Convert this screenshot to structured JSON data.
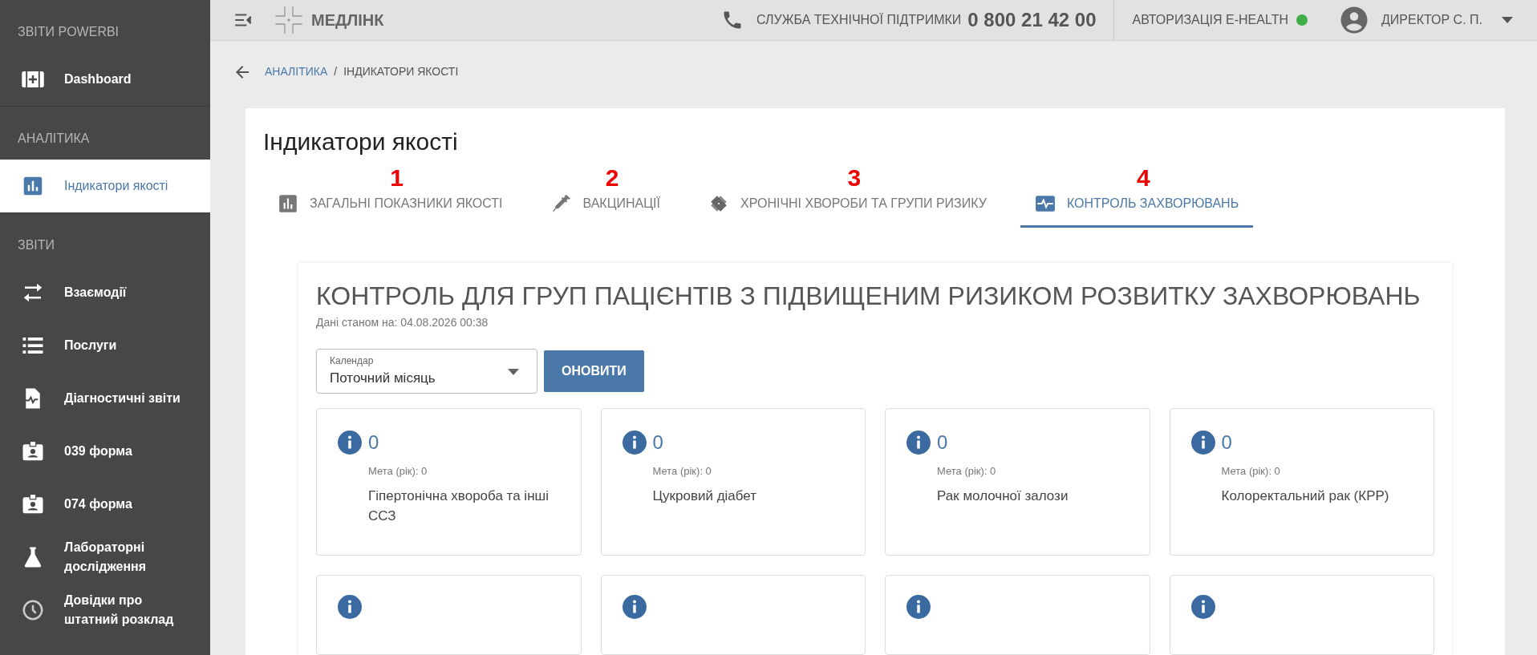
{
  "sidebar": {
    "sections": [
      {
        "title": "ЗВІТИ POWERBI",
        "items": [
          {
            "label": "Dashboard",
            "selected": false
          }
        ]
      },
      {
        "title": "АНАЛІТИКА",
        "items": [
          {
            "label": "Індикатори якості",
            "selected": true
          }
        ]
      },
      {
        "title": "ЗВІТИ",
        "items": [
          {
            "label": "Взаємодії",
            "selected": false
          },
          {
            "label": "Послуги",
            "selected": false
          },
          {
            "label": "Діагностичні звіти",
            "selected": false
          },
          {
            "label": "039 форма",
            "selected": false
          },
          {
            "label": "074 форма",
            "selected": false
          },
          {
            "label": "Лабораторні дослідження",
            "selected": false
          },
          {
            "label": "Довідки про штатний розклад",
            "selected": false
          }
        ]
      }
    ]
  },
  "header": {
    "logo": "МЕДЛІНК",
    "support_label": "СЛУЖБА ТЕХНІЧНОЇ ПІДТРИМКИ",
    "support_phone": "0 800 21 42 00",
    "auth_label": "АВТОРИЗАЦІЯ E-HEALTH",
    "auth_connected": true,
    "user": "ДИРЕКТОР С. П."
  },
  "breadcrumb": [
    {
      "label": "АНАЛІТИКА",
      "kind": "link"
    },
    {
      "label": "/",
      "kind": "separator"
    },
    {
      "label": "ІНДИКАТОРИ ЯКОСТІ",
      "kind": "current"
    }
  ],
  "page_title": "Індикатори якості",
  "tabs": [
    {
      "label": "ЗАГАЛЬНІ ПОКАЗНИКИ ЯКОСТІ",
      "marker": "1",
      "selected": false
    },
    {
      "label": "ВАКЦИНАЦІЇ",
      "marker": "2",
      "selected": false
    },
    {
      "label": "ХРОНІЧНІ ХВОРОБИ ТА ГРУПИ РИЗИКУ",
      "marker": "3",
      "selected": false
    },
    {
      "label": "КОНТРОЛЬ ЗАХВОРЮВАНЬ",
      "marker": "4",
      "selected": true
    }
  ],
  "panel": {
    "title": "КОНТРОЛЬ ДЛЯ ГРУП ПАЦІЄНТІВ З ПІДВИЩЕНИМ РИЗИКОМ РОЗВИТКУ ЗАХВОРЮВАНЬ",
    "updated": "Дані станом на: 04.08.2026 00:38",
    "calendar": {
      "label": "Календар",
      "value": "Поточний місяць"
    },
    "refresh_button": "ОНОВИТИ",
    "cards": [
      {
        "value": "0",
        "goal": "Мета (рік): 0",
        "name": "Гіпертонічна хвороба та інші ССЗ"
      },
      {
        "value": "0",
        "goal": "Мета (рік): 0",
        "name": "Цукровий діабет"
      },
      {
        "value": "0",
        "goal": "Мета (рік): 0",
        "name": "Рак молочної залози"
      },
      {
        "value": "0",
        "goal": "Мета (рік): 0",
        "name": "Колоректальний рак (КРР)"
      }
    ],
    "partial_cards": [
      {
        "kind": "info-only"
      },
      {
        "kind": "info-only"
      },
      {
        "kind": "info-only"
      },
      {
        "kind": "info-only"
      }
    ]
  }
}
